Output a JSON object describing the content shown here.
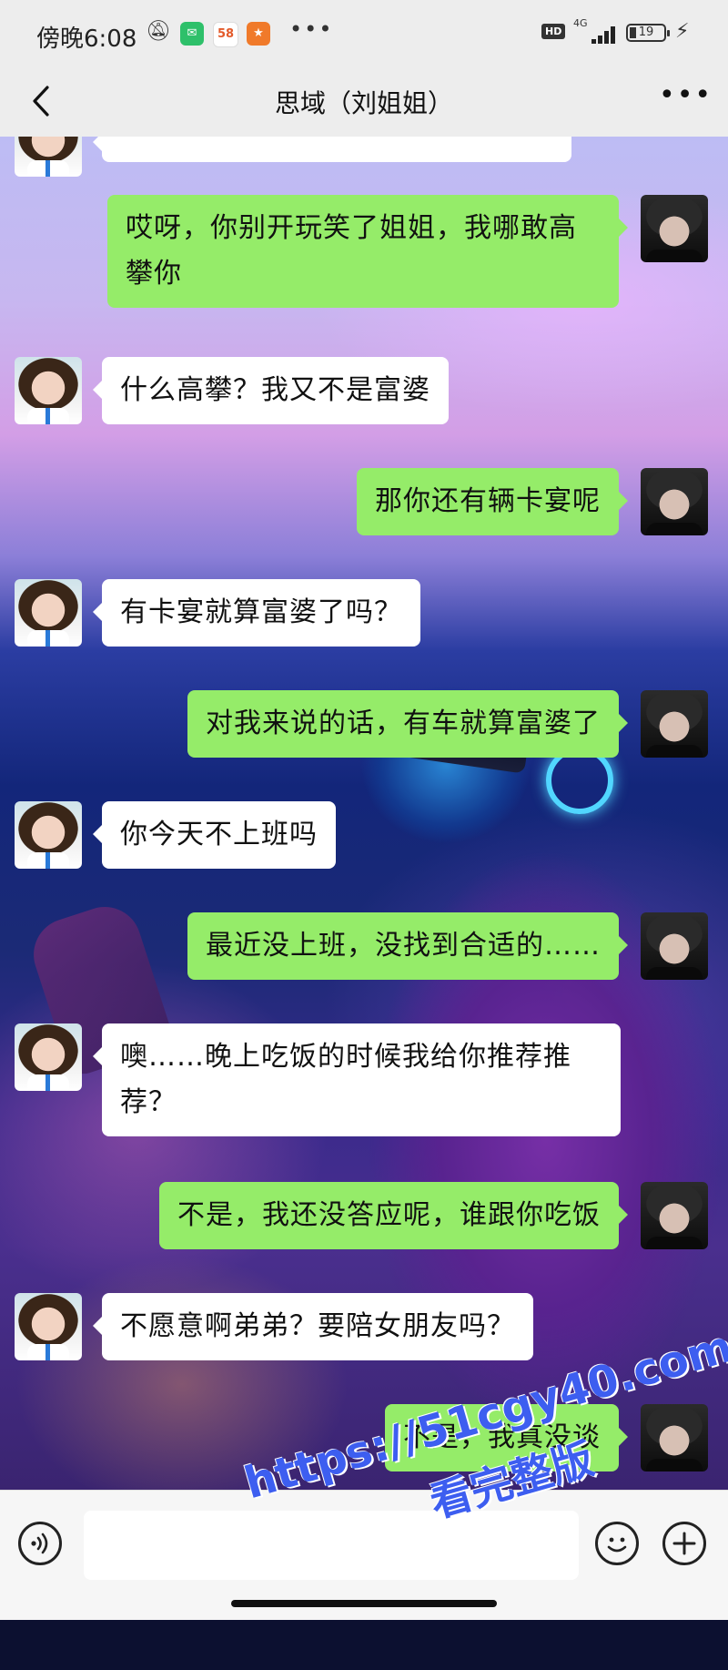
{
  "status_bar": {
    "time": "傍晚6:08",
    "app_badge_58": "58",
    "network": "4G",
    "network_sub": "4G",
    "hd": "HD",
    "battery_level": 19,
    "battery_text": "19",
    "icons": [
      "mute-bell-icon",
      "wechat-icon",
      "app-58-icon",
      "bird-app-icon",
      "more-icon",
      "hd-icon",
      "signal-icon",
      "battery-icon",
      "charging-icon"
    ]
  },
  "nav": {
    "title": "思域（刘姐姐）",
    "back_icon": "chevron-left-icon",
    "more_icon": "more-icon"
  },
  "messages": [
    {
      "side": "left",
      "text": "",
      "partial": true
    },
    {
      "side": "right",
      "text": "哎呀，你别开玩笑了姐姐，我哪敢高攀你"
    },
    {
      "side": "left",
      "text": "什么高攀？我又不是富婆"
    },
    {
      "side": "right",
      "text": "那你还有辆卡宴呢"
    },
    {
      "side": "left",
      "text": "有卡宴就算富婆了吗？"
    },
    {
      "side": "right",
      "text": "对我来说的话，有车就算富婆了"
    },
    {
      "side": "left",
      "text": "你今天不上班吗"
    },
    {
      "side": "right",
      "text": "最近没上班，没找到合适的……"
    },
    {
      "side": "left",
      "text": "噢……晚上吃饭的时候我给你推荐推荐？"
    },
    {
      "side": "right",
      "text": "不是，我还没答应呢，谁跟你吃饭"
    },
    {
      "side": "left",
      "text": "不愿意啊弟弟？要陪女朋友吗？"
    },
    {
      "side": "right",
      "text": "不是，我真没谈"
    }
  ],
  "input_bar": {
    "message_value": "",
    "icons": [
      "voice-icon",
      "emoji-icon",
      "plus-icon"
    ]
  },
  "watermark": {
    "url": "https://51cgy40.com",
    "subtitle": "看完整版"
  }
}
